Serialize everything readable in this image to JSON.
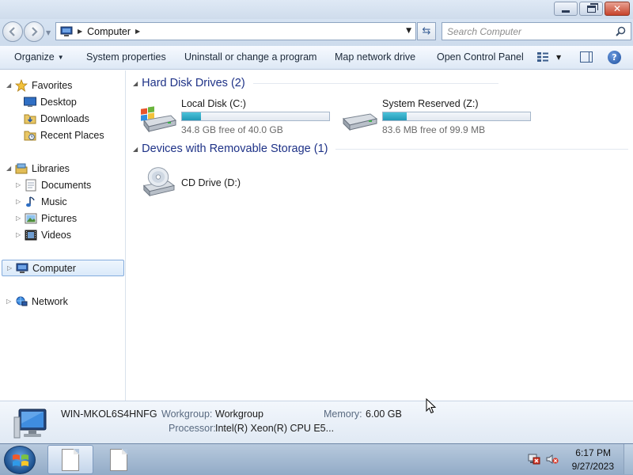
{
  "address": {
    "crumb": "Computer",
    "search_placeholder": "Search Computer"
  },
  "toolbar": {
    "organize": "Organize",
    "system_properties": "System properties",
    "uninstall": "Uninstall or change a program",
    "map_drive": "Map network drive",
    "control_panel": "Open Control Panel"
  },
  "nav": {
    "favorites": "Favorites",
    "desktop": "Desktop",
    "downloads": "Downloads",
    "recent": "Recent Places",
    "libraries": "Libraries",
    "documents": "Documents",
    "music": "Music",
    "pictures": "Pictures",
    "videos": "Videos",
    "computer": "Computer",
    "network": "Network"
  },
  "groups": {
    "hdd": "Hard Disk Drives (2)",
    "removable": "Devices with Removable Storage (1)"
  },
  "drives": [
    {
      "name": "Local Disk (C:)",
      "free": "34.8 GB free of 40.0 GB",
      "used_fraction": 0.13
    },
    {
      "name": "System Reserved (Z:)",
      "free": "83.6 MB free of 99.9 MB",
      "used_fraction": 0.16
    }
  ],
  "cd": {
    "name": "CD Drive (D:)"
  },
  "details": {
    "computer_name": "WIN-MKOL6S4HNFG",
    "workgroup_label": "Workgroup:",
    "workgroup_value": "Workgroup",
    "memory_label": "Memory:",
    "memory_value": "6.00 GB",
    "processor_label": "Processor:",
    "processor_value": "Intel(R) Xeon(R) CPU E5..."
  },
  "clock": {
    "time": "6:17 PM",
    "date": "9/27/2023"
  },
  "colors": {
    "accent": "#1e3287",
    "bar_fill": "#2aa6c2",
    "selection": "#dbeafa"
  }
}
